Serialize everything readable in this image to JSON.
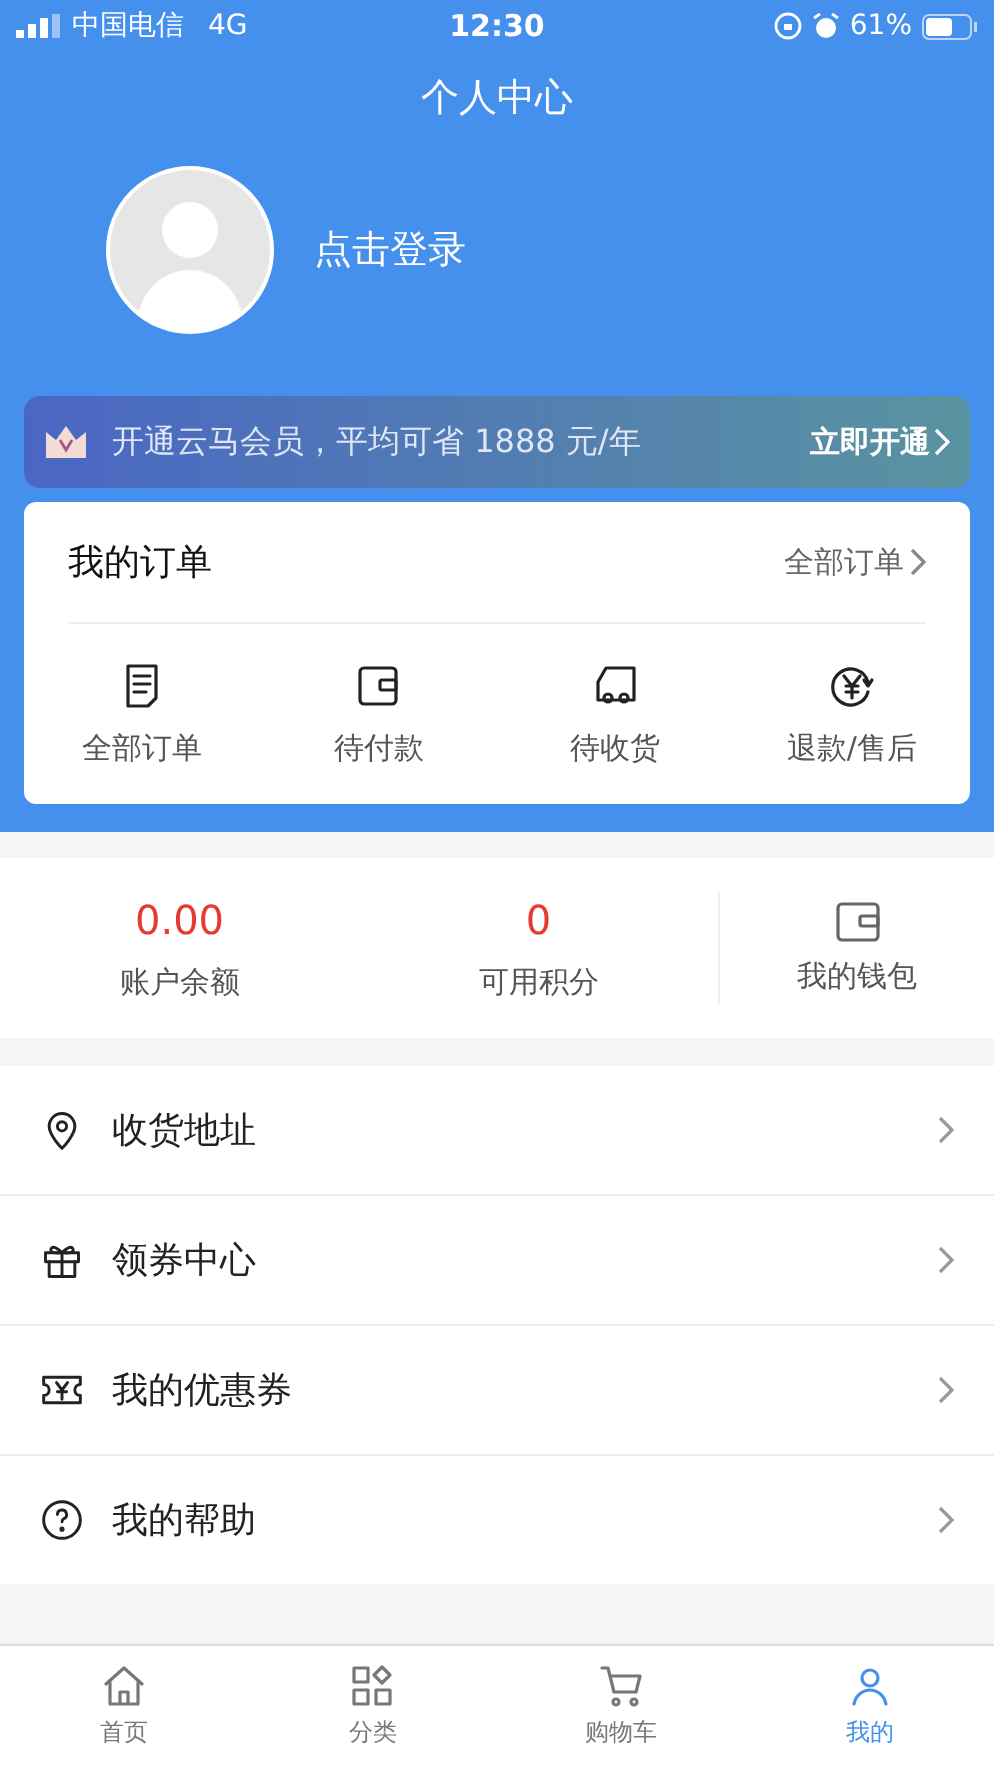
{
  "status_bar": {
    "carrier": "中国电信",
    "network": "4G",
    "time": "12:30",
    "battery": "61%"
  },
  "header": {
    "title": "个人中心",
    "login": "点击登录"
  },
  "vip_banner": {
    "text": "开通云马会员，平均可省 1888 元/年",
    "action": "立即开通"
  },
  "orders": {
    "title": "我的订单",
    "all_link": "全部订单",
    "items": [
      {
        "kind": "list",
        "label": "全部订单"
      },
      {
        "kind": "wallet",
        "label": "待付款"
      },
      {
        "kind": "truck",
        "label": "待收货"
      },
      {
        "kind": "refund",
        "label": "退款/售后"
      }
    ]
  },
  "stats": [
    {
      "value": "0.00",
      "label": "账户余额"
    },
    {
      "value": "0",
      "label": "可用积分"
    }
  ],
  "wallet": {
    "label": "我的钱包"
  },
  "menu": [
    {
      "kind": "location",
      "label": "收货地址"
    },
    {
      "kind": "gift",
      "label": "领券中心"
    },
    {
      "kind": "coupon",
      "label": "我的优惠券"
    },
    {
      "kind": "help",
      "label": "我的帮助"
    }
  ],
  "tab_bar": [
    {
      "kind": "home",
      "label": "首页",
      "selected": false
    },
    {
      "kind": "grid",
      "label": "分类",
      "selected": false
    },
    {
      "kind": "cart",
      "label": "购物车",
      "selected": false
    },
    {
      "kind": "user",
      "label": "我的",
      "selected": true
    }
  ]
}
